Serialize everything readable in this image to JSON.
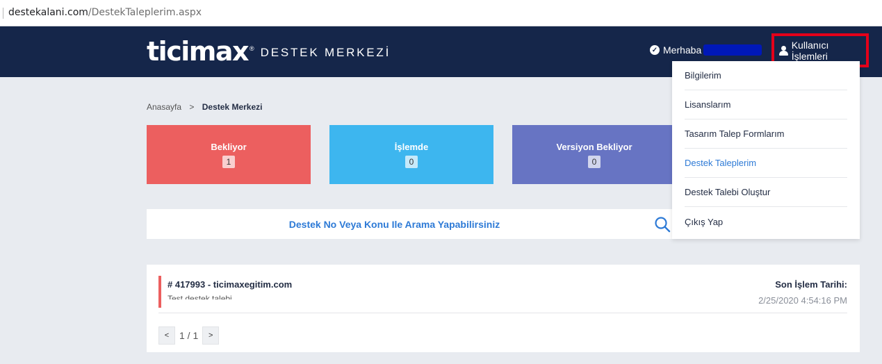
{
  "browser": {
    "url_host": "destekalani.com",
    "url_path": "/DestekTaleplerim.aspx"
  },
  "header": {
    "brand": "ticimax",
    "brand_mark": "®",
    "subtitle": "DESTEK MERKEZİ",
    "greeting": "Merhaba",
    "user_menu_label": "Kullanıcı İşlemleri",
    "background_color": "#15264a"
  },
  "breadcrumb": {
    "home": "Anasayfa",
    "separator": ">",
    "current": "Destek Merkezi"
  },
  "status_cards": [
    {
      "label": "Bekliyor",
      "count": "1",
      "color": "#ec5f5f"
    },
    {
      "label": "İşlemde",
      "count": "0",
      "color": "#3db6ef"
    },
    {
      "label": "Versiyon Bekliyor",
      "count": "0",
      "color": "#6774c3"
    }
  ],
  "search": {
    "placeholder": "Destek No Veya Konu Ile Arama Yapabilirsiniz",
    "icon": "search-icon"
  },
  "tickets": [
    {
      "number": "# 417993 - ticimaxegitim.com",
      "subject": "Test destek talebi",
      "last_action_label": "Son İşlem Tarihi:",
      "last_action_value": "2/25/2020 4:54:16 PM",
      "status_color": "#ec5f5f"
    }
  ],
  "pagination": {
    "prev": "<",
    "info": "1 / 1",
    "next": ">"
  },
  "user_menu": {
    "items": [
      {
        "label": "Bilgilerim"
      },
      {
        "label": "Lisanslarım"
      },
      {
        "label": "Tasarım Talep Formlarım"
      },
      {
        "label": "Destek Taleplerim",
        "active": true
      },
      {
        "label": "Destek Talebi Oluştur"
      },
      {
        "label": "Çıkış Yap"
      }
    ],
    "highlight_color": "#e5001a"
  }
}
